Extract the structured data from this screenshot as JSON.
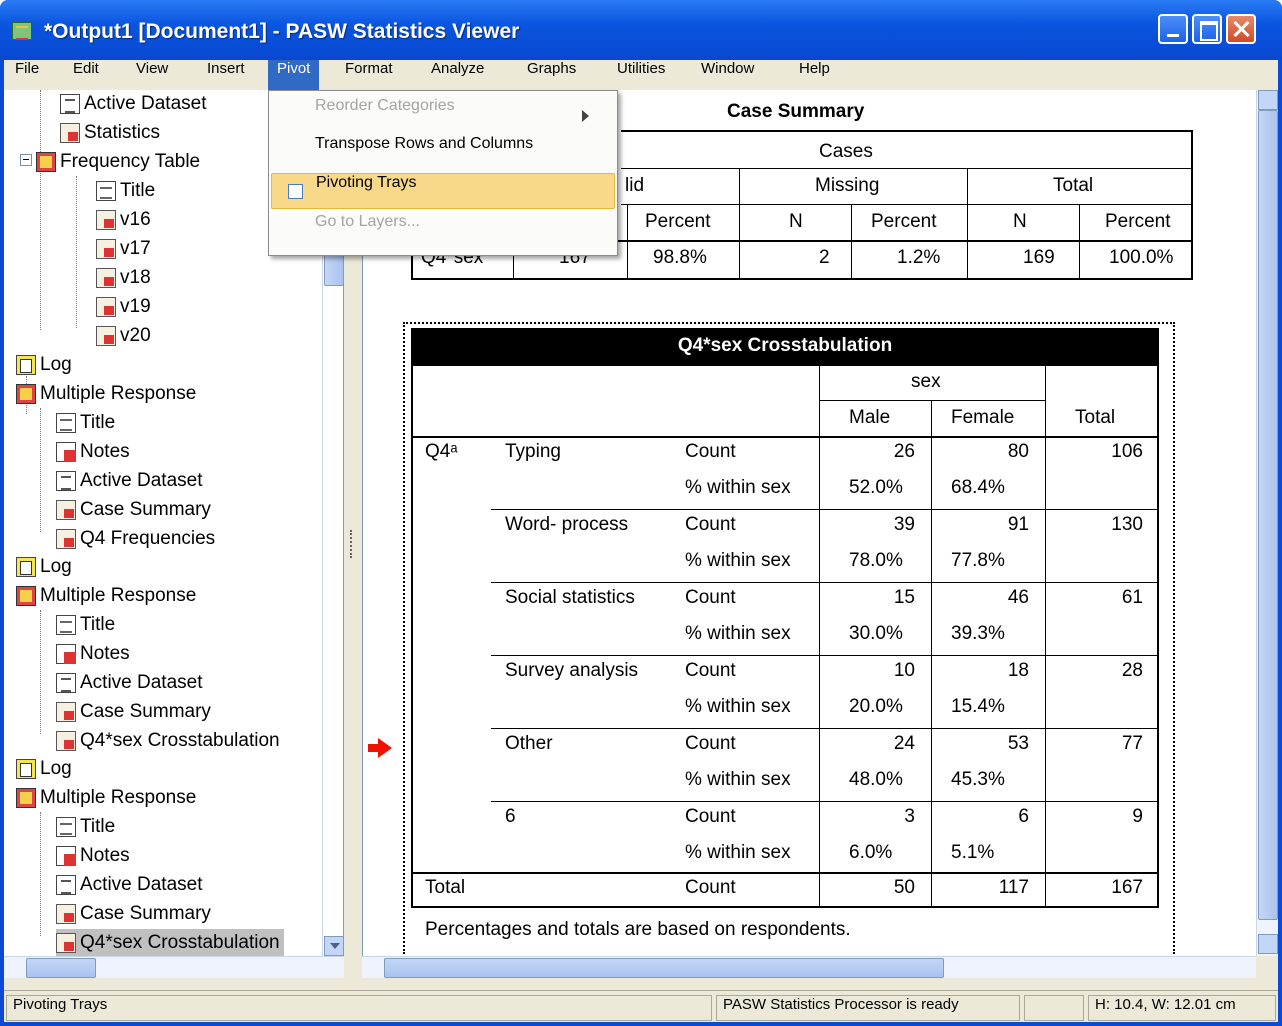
{
  "window": {
    "title": "*Output1 [Document1] - PASW Statistics Viewer"
  },
  "menubar": [
    "File",
    "Edit",
    "View",
    "Insert",
    "Pivot",
    "Format",
    "Analyze",
    "Graphs",
    "Utilities",
    "Window",
    "Help"
  ],
  "pivot_menu": {
    "items": [
      {
        "label": "Reorder Categories",
        "disabled": true,
        "submenu": true
      },
      {
        "label": "Transpose Rows and Columns",
        "disabled": false
      },
      {
        "label": "Pivoting Trays",
        "disabled": false,
        "checkbox": true,
        "checked": false
      },
      {
        "label": "Go to Layers...",
        "disabled": true
      }
    ]
  },
  "tree": {
    "nodes": [
      {
        "label": "Active Dataset",
        "icon": "dataset-icon"
      },
      {
        "label": "Statistics",
        "icon": "pivot-table-icon"
      },
      {
        "label": "Frequency Table",
        "icon": "multiple-response-icon"
      },
      {
        "label": "Title",
        "icon": "title-icon"
      },
      {
        "label": "v16",
        "icon": "pivot-table-icon"
      },
      {
        "label": "v17",
        "icon": "pivot-table-icon"
      },
      {
        "label": "v18",
        "icon": "pivot-table-icon"
      },
      {
        "label": "v19",
        "icon": "pivot-table-icon"
      },
      {
        "label": "v20",
        "icon": "pivot-table-icon"
      },
      {
        "label": "Log",
        "icon": "log-icon"
      },
      {
        "label": "Multiple Response",
        "icon": "multiple-response-icon"
      },
      {
        "label": "Title",
        "icon": "title-icon"
      },
      {
        "label": "Notes",
        "icon": "notes-icon"
      },
      {
        "label": "Active Dataset",
        "icon": "dataset-icon"
      },
      {
        "label": "Case Summary",
        "icon": "pivot-table-icon"
      },
      {
        "label": "Q4 Frequencies",
        "icon": "pivot-table-icon"
      },
      {
        "label": "Log",
        "icon": "log-icon"
      },
      {
        "label": "Multiple Response",
        "icon": "multiple-response-icon"
      },
      {
        "label": "Title",
        "icon": "title-icon"
      },
      {
        "label": "Notes",
        "icon": "notes-icon"
      },
      {
        "label": "Active Dataset",
        "icon": "dataset-icon"
      },
      {
        "label": "Case Summary",
        "icon": "pivot-table-icon"
      },
      {
        "label": "Q4*sex Crosstabulation",
        "icon": "pivot-table-icon"
      },
      {
        "label": "Log",
        "icon": "log-icon"
      },
      {
        "label": "Multiple Response",
        "icon": "multiple-response-icon"
      },
      {
        "label": "Title",
        "icon": "title-icon"
      },
      {
        "label": "Notes",
        "icon": "notes-icon"
      },
      {
        "label": "Active Dataset",
        "icon": "dataset-icon"
      },
      {
        "label": "Case Summary",
        "icon": "pivot-table-icon"
      },
      {
        "label": "Q4*sex Crosstabulation",
        "icon": "pivot-table-icon",
        "selected": true
      }
    ]
  },
  "case_summary": {
    "title": "Case Summary",
    "cases": "Cases",
    "valid": "lid",
    "missing": "Missing",
    "total": "Total",
    "percent": "Percent",
    "n": "N",
    "row_label": "Q4*sex",
    "valid_n": "167",
    "valid_pct": "98.8%",
    "missing_n": "2",
    "missing_pct": "1.2%",
    "total_n": "169",
    "total_pct": "100.0%"
  },
  "crosstab": {
    "title": "Q4*sex Crosstabulation",
    "sex": "sex",
    "male": "Male",
    "female": "Female",
    "total": "Total",
    "row_var": "Q4ᵃ",
    "rows": [
      {
        "cat": "Typing",
        "count": "Count",
        "pct": "% within sex",
        "male_n": "26",
        "female_n": "80",
        "total_n": "106",
        "male_p": "52.0%",
        "female_p": "68.4%"
      },
      {
        "cat": "Word-  process",
        "count": "Count",
        "pct": "% within sex",
        "male_n": "39",
        "female_n": "91",
        "total_n": "130",
        "male_p": "78.0%",
        "female_p": "77.8%"
      },
      {
        "cat": "Social statistics",
        "count": "Count",
        "pct": "% within sex",
        "male_n": "15",
        "female_n": "46",
        "total_n": "61",
        "male_p": "30.0%",
        "female_p": "39.3%"
      },
      {
        "cat": "Survey analysis",
        "count": "Count",
        "pct": "% within sex",
        "male_n": "10",
        "female_n": "18",
        "total_n": "28",
        "male_p": "20.0%",
        "female_p": "15.4%"
      },
      {
        "cat": "Other",
        "count": "Count",
        "pct": "% within sex",
        "male_n": "24",
        "female_n": "53",
        "total_n": "77",
        "male_p": "48.0%",
        "female_p": "45.3%"
      },
      {
        "cat": "6",
        "count": "Count",
        "pct": "% within sex",
        "male_n": "3",
        "female_n": "6",
        "total_n": "9",
        "male_p": "6.0%",
        "female_p": "5.1%"
      }
    ],
    "total_row": {
      "label": "Total",
      "count": "Count",
      "male": "50",
      "female": "117",
      "total": "167"
    },
    "footnote": "Percentages and totals are based on respondents."
  },
  "statusbar": {
    "left": "Pivoting Trays",
    "processor": "PASW Statistics Processor is ready",
    "dims": "H: 10.4, W: 12.01 cm"
  }
}
